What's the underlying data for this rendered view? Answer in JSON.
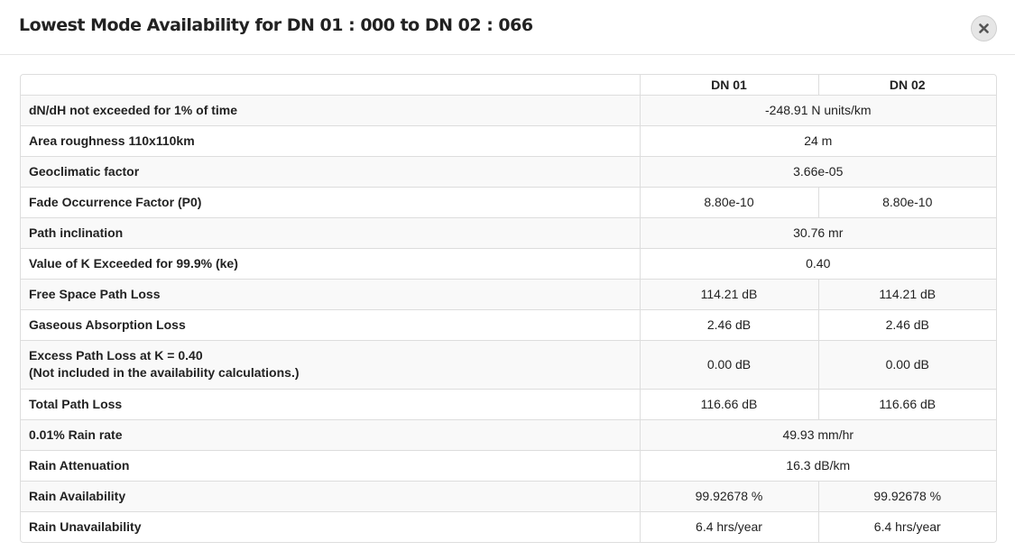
{
  "modal": {
    "title": "Lowest Mode Availability for DN 01 : 000 to DN 02 : 066",
    "close_icon": "close-icon"
  },
  "table": {
    "headers": [
      "",
      "DN 01",
      "DN 02"
    ],
    "rows": [
      {
        "label": "dN/dH not exceeded for 1% of time",
        "merged": true,
        "value": "-248.91 N units/km"
      },
      {
        "label": "Area roughness 110x110km",
        "merged": true,
        "value": "24 m"
      },
      {
        "label": "Geoclimatic factor",
        "merged": true,
        "value": "3.66e-05"
      },
      {
        "label": "Fade Occurrence Factor (P0)",
        "merged": false,
        "dn01": "8.80e-10",
        "dn02": "8.80e-10"
      },
      {
        "label": "Path inclination",
        "merged": true,
        "value": "30.76 mr"
      },
      {
        "label": "Value of K Exceeded for 99.9% (ke)",
        "merged": true,
        "value": "0.40"
      },
      {
        "label": "Free Space Path Loss",
        "merged": false,
        "dn01": "114.21 dB",
        "dn02": "114.21 dB"
      },
      {
        "label": "Gaseous Absorption Loss",
        "merged": false,
        "dn01": "2.46 dB",
        "dn02": "2.46 dB"
      },
      {
        "label": "Excess Path Loss at K = 0.40",
        "sublabel": "(Not included in the availability calculations.)",
        "merged": false,
        "dn01": "0.00 dB",
        "dn02": "0.00 dB"
      },
      {
        "label": "Total Path Loss",
        "merged": false,
        "dn01": "116.66 dB",
        "dn02": "116.66 dB"
      },
      {
        "label": "0.01% Rain rate",
        "merged": true,
        "value": "49.93 mm/hr"
      },
      {
        "label": "Rain Attenuation",
        "merged": true,
        "value": "16.3 dB/km"
      },
      {
        "label": "Rain Availability",
        "merged": false,
        "dn01": "99.92678 %",
        "dn02": "99.92678 %"
      },
      {
        "label": "Rain Unavailability",
        "merged": false,
        "dn01": "6.4 hrs/year",
        "dn02": "6.4 hrs/year"
      }
    ]
  }
}
